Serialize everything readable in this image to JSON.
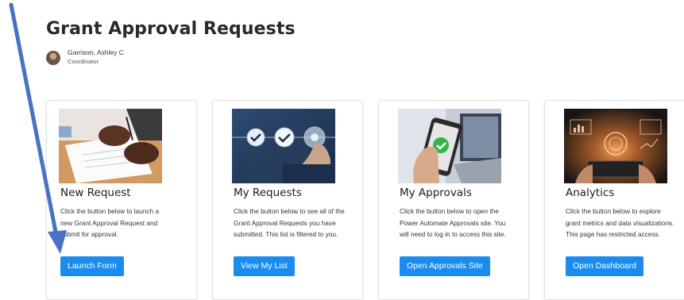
{
  "page": {
    "title": "Grant Approval Requests",
    "author_name": "Garrison, Ashley C",
    "author_role": "Coordinator"
  },
  "cards": [
    {
      "title": "New Request",
      "description": "Click the button below to launch a new Grant Approval Request and submit for approval.",
      "button": "Launch Form",
      "image": "signing-document-image"
    },
    {
      "title": "My Requests",
      "description": "Click the button below to see all of the Grant Approval Requests you have submitted. This list is filtered to you.",
      "button": "View My List",
      "image": "checkmarks-touch-image"
    },
    {
      "title": "My Approvals",
      "description": "Click the button below to open the Power Automate Approvals site. You will need to log in to access this site.",
      "button": "Open Approvals Site",
      "image": "phone-checkmark-image"
    },
    {
      "title": "Analytics",
      "description": "Click the button below to explore grant metrics and data visualizations. This page has restricted access.",
      "button": "Open Dashboard",
      "image": "data-dashboard-image"
    }
  ],
  "colors": {
    "button": "#1a8cf0",
    "annotation_arrow": "#4a72c4"
  }
}
